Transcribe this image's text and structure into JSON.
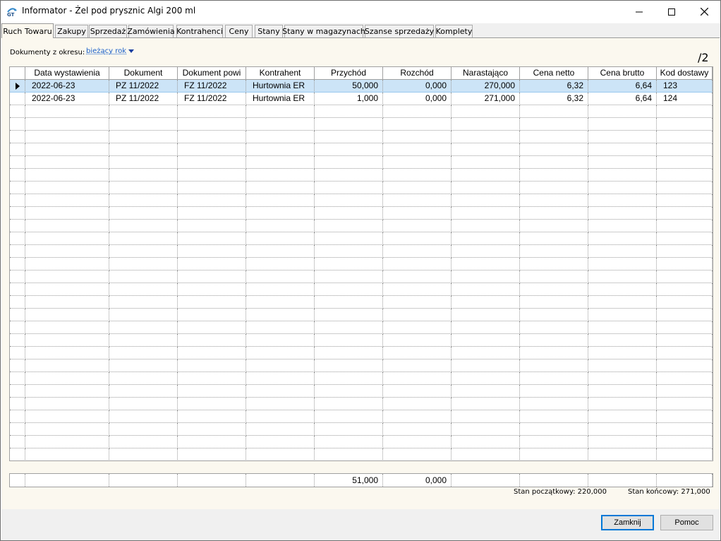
{
  "window": {
    "title": "Informator - Żel pod prysznic Algi 200 ml",
    "icon": "informator-app-icon",
    "controls": [
      "minimize-icon",
      "maximize-icon",
      "close-icon"
    ]
  },
  "tabs": [
    {
      "label": "Ruch Towaru",
      "active": true
    },
    {
      "label": "Zakupy"
    },
    {
      "label": "Sprzedaż"
    },
    {
      "label": "Zamówienia"
    },
    {
      "label": "Kontrahenci"
    },
    {
      "label": "Ceny"
    },
    {
      "label": "Stany"
    },
    {
      "label": "Stany w magazynach"
    },
    {
      "label": "Szanse sprzedaży"
    },
    {
      "label": "Komplety"
    }
  ],
  "filter": {
    "label": "Dokumenty z okresu:",
    "value": "bieżący rok"
  },
  "page_indicator": "/2",
  "table": {
    "columns": [
      "",
      "Data wystawienia",
      "Dokument",
      "Dokument powi",
      "Kontrahent",
      "Przychód",
      "Rozchód",
      "Narastająco",
      "Cena netto",
      "Cena brutto",
      "Kod dostawy"
    ],
    "rows": [
      [
        "2022-06-23",
        "PZ 11/2022",
        "FZ 11/2022",
        "Hurtownia ER",
        "50,000",
        "0,000",
        "270,000",
        "6,32",
        "6,64",
        "123"
      ],
      [
        "2022-06-23",
        "PZ 11/2022",
        "FZ 11/2022",
        "Hurtownia ER",
        "1,000",
        "0,000",
        "271,000",
        "6,32",
        "6,64",
        "124"
      ]
    ],
    "selected_row": 0,
    "totals": {
      "przychod": "51,000",
      "rozchod": "0,000"
    }
  },
  "summary": {
    "start_label": "Stan początkowy:",
    "start_value": "220,000",
    "end_label": "Stan końcowy:",
    "end_value": "271,000"
  },
  "buttons": {
    "close": "Zamknij",
    "help": "Pomoc"
  },
  "colors": {
    "panel_bg": "#fbf8ef",
    "selection": "#cce4f7",
    "link": "#1a5fc8",
    "default_button_border": "#0078d7"
  }
}
